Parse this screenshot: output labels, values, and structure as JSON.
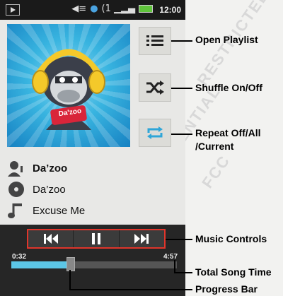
{
  "status_bar": {
    "time": "12:00",
    "icons": [
      "media-play-icon",
      "volume-icon",
      "globe-icon",
      "signal-icon",
      "battery-icon"
    ]
  },
  "album_art": {
    "label": "Da'zoo album art",
    "brand_text": "Da'zoo"
  },
  "side_buttons": [
    {
      "icon": "playlist-icon"
    },
    {
      "icon": "shuffle-icon"
    },
    {
      "icon": "repeat-icon"
    }
  ],
  "track": {
    "artist": "Da’zoo",
    "album": "Da’zoo",
    "song": "Excuse Me"
  },
  "controls": {
    "elapsed": "0:32",
    "total": "4:57",
    "progress_fraction": 0.36
  },
  "callouts": {
    "open_playlist": "Open Playlist",
    "shuffle": "Shuffle On/Off",
    "repeat_line1": "Repeat Off/All",
    "repeat_line2": "/Current",
    "music_controls": "Music Controls",
    "total_song_time": "Total Song Time",
    "progress_bar": "Progress Bar"
  },
  "colors": {
    "accent_blue": "#5cc6e6",
    "highlight_red": "#e0352b",
    "battery_green": "#5fc43b"
  }
}
